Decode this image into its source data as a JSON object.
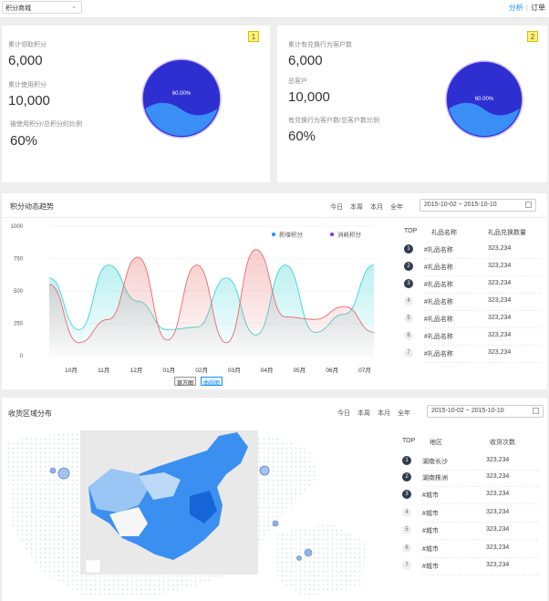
{
  "topbar": {
    "select_value": "积分商城",
    "links": [
      "分析",
      "订单"
    ],
    "separator": "|"
  },
  "card1": {
    "badge": "1",
    "stats": [
      {
        "label": "累计领取积分",
        "value": "6,000"
      },
      {
        "label": "累计使用积分",
        "value": "10,000"
      },
      {
        "label": "被使用积分/总积分的比例",
        "value": "60%"
      }
    ],
    "gauge_label": "60.00%",
    "gauge_fraction": 0.6
  },
  "card2": {
    "badge": "2",
    "stats": [
      {
        "label": "累计有兑换行为客户数",
        "value": "6,000"
      },
      {
        "label": "总客户",
        "value": "10,000"
      },
      {
        "label": "有兑换行为客户数/总客户数比例",
        "value": "60%"
      }
    ],
    "gauge_label": "60.00%",
    "gauge_fraction": 0.6
  },
  "trend": {
    "title": "积分动态趋势",
    "filters": [
      "今日",
      "本周",
      "本月",
      "全年"
    ],
    "date_from": "2015-10-02",
    "date_to": "2015-10-10",
    "date_sep": "~",
    "toggle_buttons": [
      "直方图",
      "曲线图"
    ],
    "rank_headers": [
      "TOP",
      "礼品名称",
      "礼品兑换数量"
    ],
    "rank_rows": [
      {
        "n": "1",
        "name": "#礼品名称",
        "count": "323,234"
      },
      {
        "n": "2",
        "name": "#礼品名称",
        "count": "323,234"
      },
      {
        "n": "3",
        "name": "#礼品名称",
        "count": "323,234"
      },
      {
        "n": "4",
        "name": "#礼品名称",
        "count": "323,234"
      },
      {
        "n": "5",
        "name": "#礼品名称",
        "count": "323,234"
      },
      {
        "n": "6",
        "name": "#礼品名称",
        "count": "323,234"
      },
      {
        "n": "7",
        "name": "#礼品名称",
        "count": "323,234"
      }
    ]
  },
  "region": {
    "title": "收货区域分布",
    "filters": [
      "今日",
      "本周",
      "本月",
      "全年"
    ],
    "date_from": "2015-10-02",
    "date_to": "2015-10-10",
    "date_sep": "~",
    "rank_headers": [
      "TOP",
      "地区",
      "收货次数"
    ],
    "rank_rows": [
      {
        "n": "1",
        "name": "湖南长沙",
        "count": "323,234"
      },
      {
        "n": "2",
        "name": "湖南株洲",
        "count": "323,234"
      },
      {
        "n": "3",
        "name": "#城市",
        "count": "323,234"
      },
      {
        "n": "4",
        "name": "#城市",
        "count": "323,234"
      },
      {
        "n": "5",
        "name": "#城市",
        "count": "323,234"
      },
      {
        "n": "6",
        "name": "#城市",
        "count": "323,234"
      },
      {
        "n": "7",
        "name": "#城市",
        "count": "323,234"
      }
    ]
  },
  "chart_data": {
    "type": "area",
    "categories": [
      "10月",
      "11月",
      "12月",
      "01月",
      "02月",
      "03月",
      "04月",
      "05月",
      "06月",
      "07月"
    ],
    "ylim": [
      0,
      1000
    ],
    "yticks": [
      0,
      250,
      500,
      750,
      1000
    ],
    "legend_position": "top-right",
    "series": [
      {
        "name": "新增积分",
        "color": "#3fd5d5",
        "values": [
          600,
          200,
          700,
          420,
          200,
          220,
          600,
          160,
          700,
          180,
          320,
          700
        ]
      },
      {
        "name": "消耗积分",
        "color": "#e86a6a",
        "values": [
          550,
          100,
          280,
          760,
          120,
          700,
          100,
          820,
          300,
          280,
          380,
          180
        ]
      }
    ]
  }
}
